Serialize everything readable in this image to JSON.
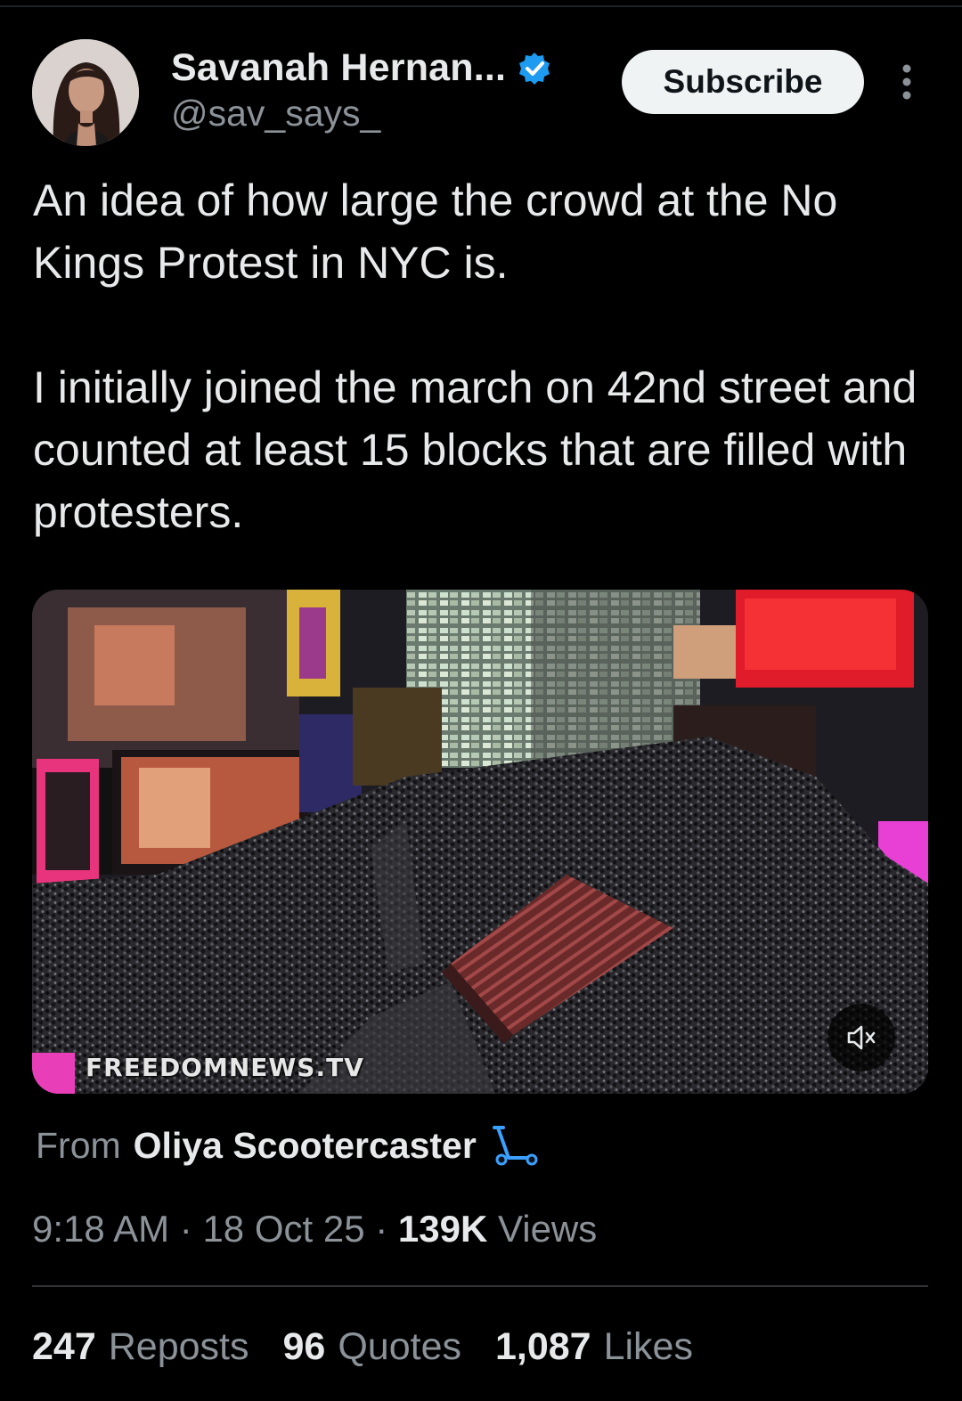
{
  "author": {
    "display_name": "Savanah Hernan...",
    "handle": "@sav_says_",
    "verified": true,
    "verified_color": "#1d9bf0"
  },
  "header": {
    "subscribe_label": "Subscribe",
    "more_icon": "more-vertical-icon"
  },
  "tweet": {
    "paragraphs": [
      "An idea of how large the crowd at the No Kings Protest in NYC is.",
      "I initially joined the march on 42nd street and counted at least 15 blocks that are filled with protesters."
    ]
  },
  "media": {
    "type": "video",
    "watermark": "FREEDOMNEWS.TV",
    "muted": true,
    "mute_icon": "speaker-muted-icon"
  },
  "attribution": {
    "from_label": "From",
    "source_name": "Oliya Scootercaster",
    "source_icon": "scooter-icon"
  },
  "meta": {
    "time": "9:18 AM",
    "separator": "·",
    "date": "18 Oct 25",
    "views_count": "139K",
    "views_label": "Views"
  },
  "stats": {
    "reposts_count": "247",
    "reposts_label": "Reposts",
    "quotes_count": "96",
    "quotes_label": "Quotes",
    "likes_count": "1,087",
    "likes_label": "Likes"
  },
  "colors": {
    "background": "#000000",
    "text_primary": "#e7e9ea",
    "text_secondary": "#8b9298",
    "divider": "#2f3336",
    "button_bg": "#eff3f4"
  }
}
